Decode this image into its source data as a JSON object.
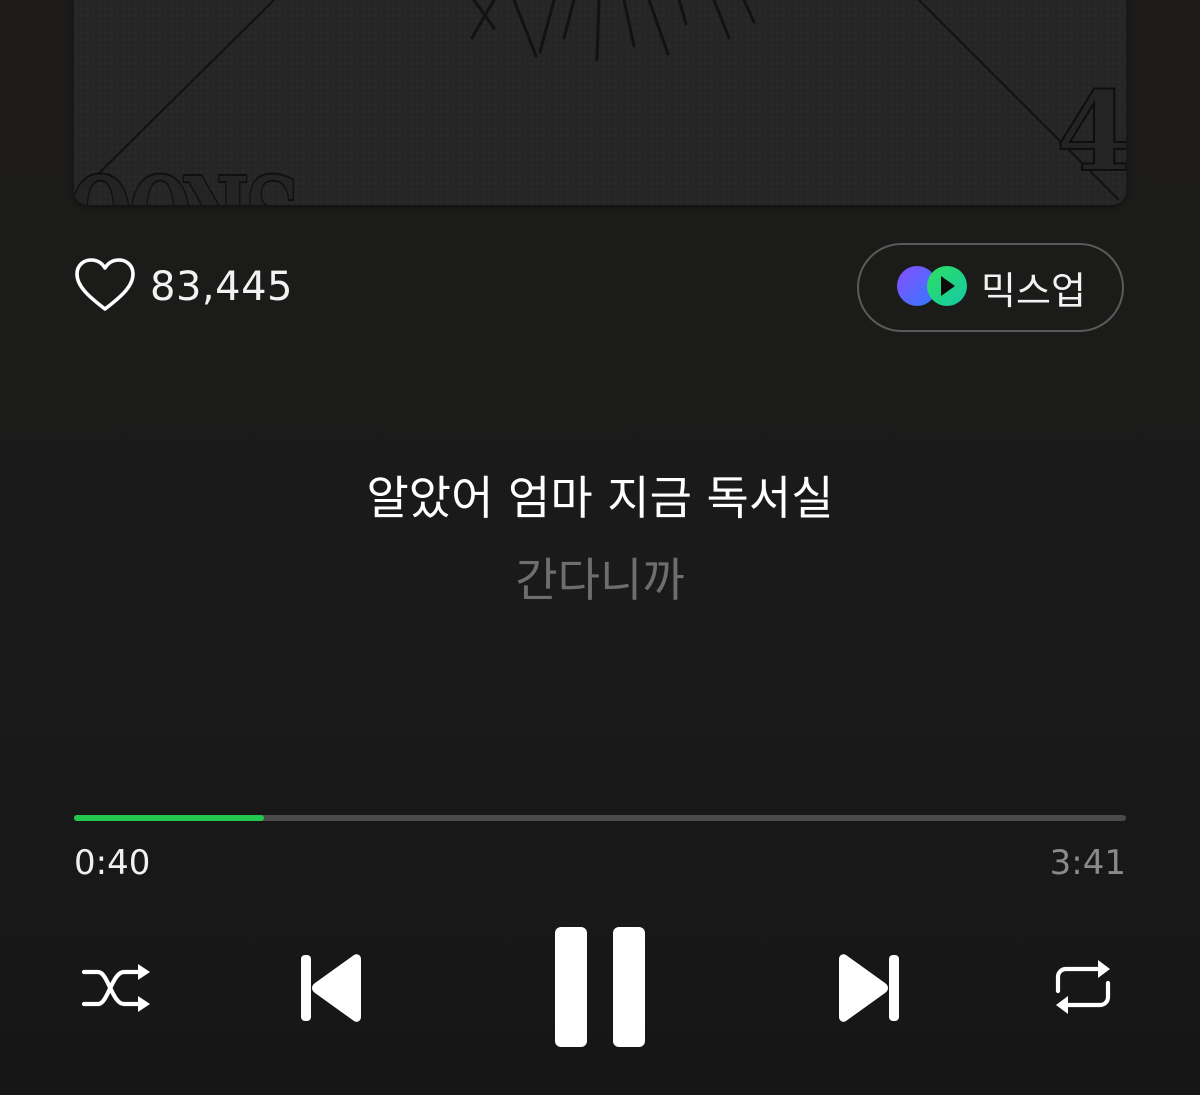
{
  "likes": {
    "count": "83,445"
  },
  "mixup": {
    "label": "믹스업"
  },
  "lyrics": {
    "current": "알았어 엄마 지금 독서실",
    "next": "간다니까"
  },
  "playback": {
    "elapsed": "0:40",
    "total": "3:41",
    "progress_fraction": 0.181
  },
  "colors": {
    "accent": "#22c94e",
    "background": "#1a1a1a",
    "dim_text": "#6e6e6e"
  },
  "icons": {
    "like": "heart-outline-icon",
    "mixup": "mixup-logo-icon",
    "shuffle": "shuffle-icon",
    "previous": "skip-previous-icon",
    "play_pause": "pause-icon",
    "next": "skip-next-icon",
    "repeat": "repeat-icon"
  }
}
